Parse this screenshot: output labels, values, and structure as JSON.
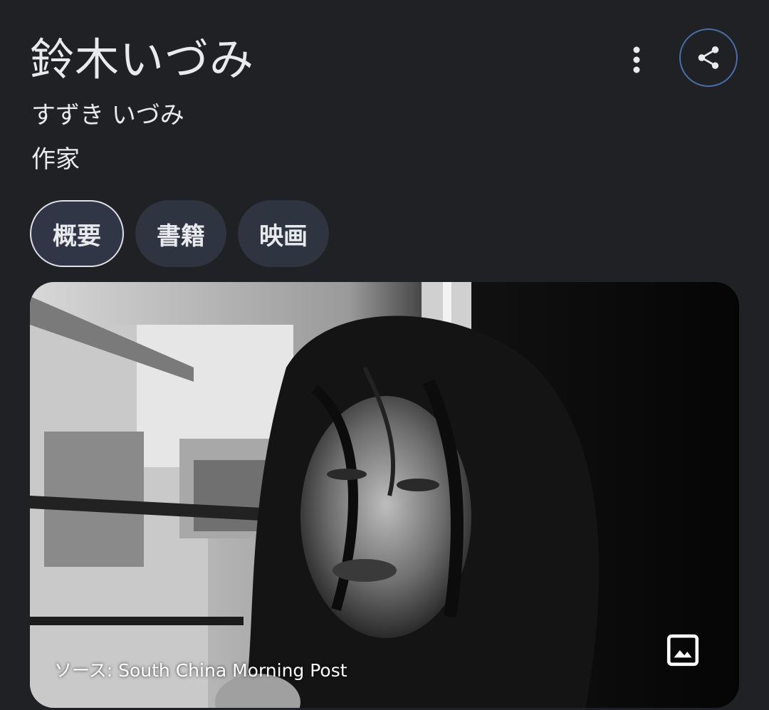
{
  "entity": {
    "name": "鈴木いづみ",
    "reading": "すずき いづみ",
    "description": "作家"
  },
  "actions": {
    "more_icon": "more-vert-icon",
    "share_icon": "share-icon"
  },
  "tabs": [
    {
      "label": "概要",
      "active": true
    },
    {
      "label": "書籍",
      "active": false
    },
    {
      "label": "映画",
      "active": false
    }
  ],
  "image": {
    "credit": "ソース: South China Morning Post",
    "icon": "image-icon"
  },
  "colors": {
    "background": "#202124",
    "chip": "#2f3441",
    "share_ring": "#4a6fa5",
    "text": "#e8eaed"
  }
}
